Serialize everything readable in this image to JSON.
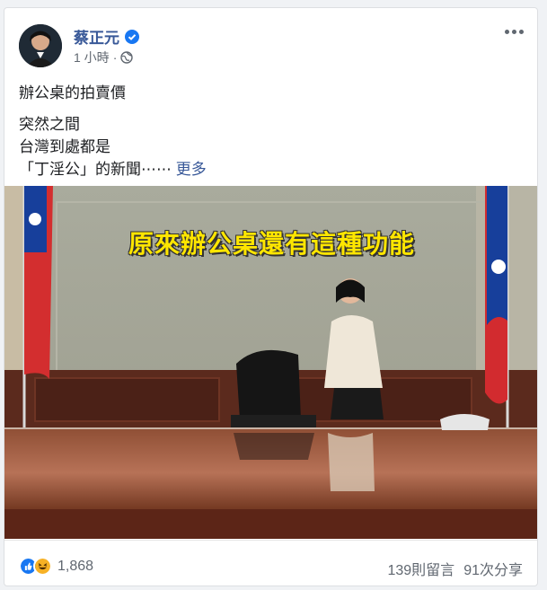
{
  "post": {
    "author": "蔡正元",
    "time": "1 小時",
    "lines": [
      "辦公桌的拍賣價",
      "突然之間",
      "台灣到處都是",
      "「丁淫公」的新聞⋯⋯"
    ],
    "see_more": "更多",
    "photo_caption": "原來辦公桌還有這種功能"
  },
  "footer": {
    "reaction_count": "1,868",
    "comments": "139則留言",
    "shares": "91次分享"
  },
  "icons": {
    "verified": "verified-badge-icon",
    "privacy": "globe-icon",
    "menu": "more-horizontal-icon",
    "like": "like-reaction-icon",
    "haha": "haha-reaction-icon"
  },
  "colors": {
    "link": "#385898",
    "verified": "#1877f2",
    "muted": "#606770"
  }
}
